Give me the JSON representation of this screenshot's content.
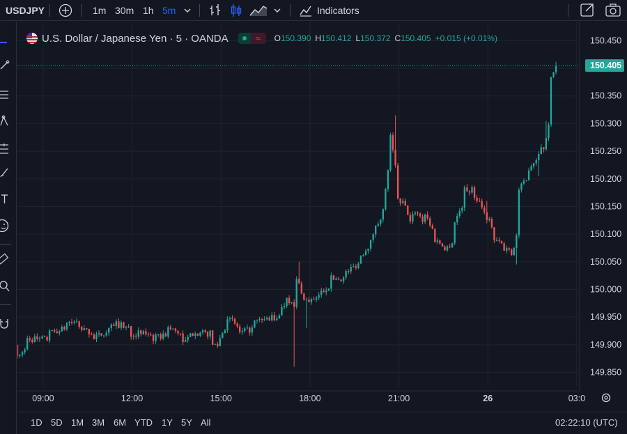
{
  "toolbar": {
    "symbol": "USDJPY",
    "add_symbol_icon": "plus-circle-icon",
    "timeframes": [
      "1m",
      "30m",
      "1h",
      "5m"
    ],
    "active_timeframe": "5m",
    "indicators_label": "Indicators"
  },
  "legend": {
    "title": "U.S. Dollar / Japanese Yen · 5 · OANDA",
    "wave_symbol": "≈",
    "open_key": "O",
    "open": "150.390",
    "high_key": "H",
    "high": "150.412",
    "low_key": "L",
    "low": "150.372",
    "close_key": "C",
    "close": "150.405",
    "change": "+0.015 (+0.01%)"
  },
  "colors": {
    "background": "#131722",
    "up": "#26a69a",
    "down": "#ef5350",
    "grid": "#1f2430",
    "accent": "#2962ff"
  },
  "range_buttons": [
    "1D",
    "5D",
    "1M",
    "3M",
    "6M",
    "YTD",
    "1Y",
    "5Y",
    "All"
  ],
  "clock": "02:22:10 (UTC)",
  "chart_data": {
    "type": "candlestick",
    "title": "U.S. Dollar / Japanese Yen · 5 · OANDA",
    "interval_minutes": 5,
    "y_ticks": [
      "150.450",
      "150.400",
      "150.350",
      "150.300",
      "150.250",
      "150.200",
      "150.150",
      "150.100",
      "150.050",
      "150.000",
      "149.950",
      "149.900",
      "149.850"
    ],
    "ylim": [
      149.8229,
      150.4845
    ],
    "x_ticks": [
      "09:00",
      "12:00",
      "15:00",
      "18:00",
      "21:00",
      "26",
      "03:0"
    ],
    "x_tick_times": [
      "08:58",
      "11:58",
      "14:58",
      "17:58",
      "20:58",
      "23:58",
      "02:58"
    ],
    "xlim": [
      "08:06",
      "03:01"
    ],
    "last_price": "150.405",
    "grid": true,
    "anchors": [
      [
        "08:06",
        149.9,
        149.88
      ],
      [
        "08:30",
        149.89,
        149.91
      ],
      [
        "09:15",
        149.91,
        149.92
      ],
      [
        "09:50",
        149.93,
        149.94
      ],
      [
        "10:15",
        149.94,
        149.93
      ],
      [
        "10:45",
        149.92,
        149.91
      ],
      [
        "11:20",
        149.93,
        149.94
      ],
      [
        "12:00",
        149.93,
        149.92
      ],
      [
        "12:45",
        149.92,
        149.91
      ],
      [
        "13:15",
        149.92,
        149.93
      ],
      [
        "13:45",
        149.92,
        149.9
      ],
      [
        "14:15",
        149.93,
        149.92
      ],
      [
        "14:45",
        149.92,
        149.9
      ],
      [
        "15:00",
        149.9,
        149.91
      ],
      [
        "15:15",
        149.94,
        149.95
      ],
      [
        "15:40",
        149.93,
        149.92
      ],
      [
        "16:10",
        149.93,
        149.94
      ],
      [
        "16:50",
        149.95,
        149.94
      ],
      [
        "17:15",
        149.98,
        149.99
      ],
      [
        "17:35",
        149.96,
        150.02
      ],
      [
        "17:50",
        149.99,
        149.98
      ],
      [
        "18:20",
        149.98,
        149.99
      ],
      [
        "18:45",
        150.01,
        150.02
      ],
      [
        "19:15",
        150.02,
        150.03
      ],
      [
        "19:45",
        150.05,
        150.06
      ],
      [
        "20:10",
        150.09,
        150.1
      ],
      [
        "20:35",
        150.15,
        150.17
      ],
      [
        "20:45",
        150.25,
        150.28
      ],
      [
        "21:00",
        150.2,
        150.17
      ],
      [
        "21:10",
        150.14,
        150.16
      ],
      [
        "21:25",
        150.13,
        150.12
      ],
      [
        "21:40",
        150.15,
        150.14
      ],
      [
        "21:55",
        150.12,
        150.14
      ],
      [
        "22:15",
        150.1,
        150.09
      ],
      [
        "22:35",
        150.08,
        150.07
      ],
      [
        "22:55",
        150.09,
        150.12
      ],
      [
        "23:15",
        150.16,
        150.18
      ],
      [
        "23:35",
        150.18,
        150.17
      ],
      [
        "23:55",
        150.15,
        150.14
      ],
      [
        "00:15",
        150.11,
        150.09
      ],
      [
        "00:35",
        150.08,
        150.07
      ],
      [
        "00:50",
        150.08,
        150.06
      ],
      [
        "01:05",
        150.11,
        150.18
      ],
      [
        "01:25",
        150.2,
        150.22
      ],
      [
        "01:45",
        150.24,
        150.25
      ],
      [
        "02:00",
        150.26,
        150.27
      ],
      [
        "02:10",
        150.31,
        150.39
      ],
      [
        "02:20",
        150.39,
        150.405
      ]
    ],
    "wicks": [
      [
        "17:25",
        149.86
      ],
      [
        "17:35",
        150.05
      ],
      [
        "17:50",
        149.93
      ],
      [
        "20:50",
        150.315
      ],
      [
        "23:55",
        150.16
      ],
      [
        "00:55",
        150.045
      ],
      [
        "01:40",
        150.205
      ],
      [
        "01:55",
        150.305
      ],
      [
        "02:20",
        150.412
      ]
    ]
  }
}
